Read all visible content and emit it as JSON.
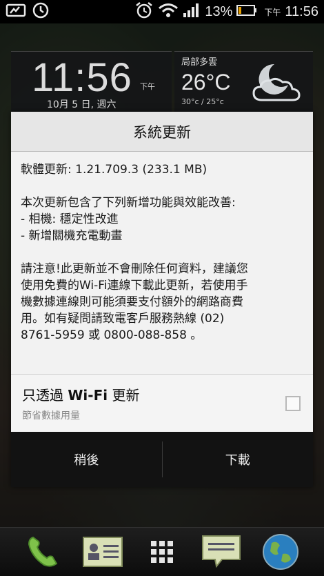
{
  "status_bar": {
    "battery_percent": "13%",
    "ampm": "下午",
    "time": "11:56",
    "icons": [
      "screen-icon",
      "alarm-icon",
      "alarm-clock-icon",
      "wifi-icon",
      "signal-icon",
      "battery-icon"
    ]
  },
  "clock_widget": {
    "time": "11:56",
    "ampm": "下午",
    "date": "10月 5 日, 週六"
  },
  "weather_widget": {
    "location": "局部多雲",
    "temperature": "26°C",
    "range": "30°c / 25°c",
    "icon": "partly-cloudy-night-icon"
  },
  "dialog": {
    "title": "系統更新",
    "version_line": "軟體更新: 1.21.709.3 (233.1 MB)",
    "intro": "本次更新包含了下列新增功能與效能改善:",
    "features": [
      "- 相機: 穩定性改進",
      "- 新增關機充電動畫"
    ],
    "notice": [
      "請注意!此更新並不會刪除任何資料，建議您",
      "使用免費的Wi-Fi連線下載此更新，若使用手",
      "機數據連線則可能須要支付額外的網路商費",
      "用。如有疑問請致電客戶服務熱線 (02)",
      "8761-5959 或 0800-088-858 。"
    ],
    "option": {
      "title_prefix": "只透過 ",
      "title_bold": "Wi-Fi",
      "title_suffix": " 更新",
      "subtitle": "節省數據用量",
      "checked": false
    },
    "buttons": {
      "later": "稍後",
      "download": "下載"
    }
  },
  "dock": {
    "items": [
      "phone-icon",
      "contacts-icon",
      "apps-grid-icon",
      "messages-icon",
      "globe-browser-icon"
    ]
  },
  "colors": {
    "dialog_bg": "#f2f2f2",
    "button_bar": "#121212",
    "status_bar": "#000000"
  }
}
